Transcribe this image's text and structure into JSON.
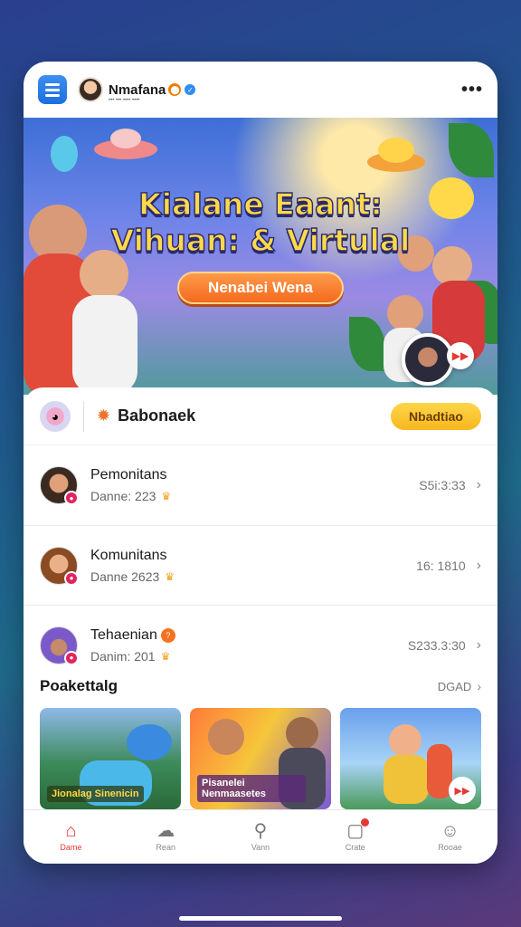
{
  "header": {
    "username": "Nmafana",
    "subtitle": "••• ••• •••• ••••",
    "more": "•••"
  },
  "banner": {
    "title_line1": "Kialane Eaant:",
    "title_line2": "Vihuan: & Virtulal",
    "cta_label": "Nenabei Wena"
  },
  "bonus": {
    "label": "Babonaek",
    "button_label": "Nbadtiao"
  },
  "list": [
    {
      "title": "Pemonitans",
      "sub": "Danne: 223",
      "value": "S5i:3:33",
      "badge": ""
    },
    {
      "title": "Komunitans",
      "sub": "Danne 2623",
      "value": "16: 1810",
      "badge": ""
    },
    {
      "title": "Tehaenian",
      "sub": "Danim: 201",
      "value": "S233.3:30",
      "badge": "?"
    }
  ],
  "section": {
    "title": "Poakettalg",
    "link": "DGAD"
  },
  "cards": [
    {
      "label": "Jionalag Sinenicin"
    },
    {
      "label": "Pisanelei Nenmaasetes"
    },
    {
      "label": ""
    }
  ],
  "bottom_nav": [
    {
      "label": "Dame",
      "icon": "home-icon"
    },
    {
      "label": "Rean",
      "icon": "discover-icon"
    },
    {
      "label": "Vann",
      "icon": "search-icon"
    },
    {
      "label": "Crate",
      "icon": "chat-icon"
    },
    {
      "label": "Rooae",
      "icon": "profile-icon"
    }
  ],
  "colors": {
    "accent": "#e53935",
    "cta_orange": "#f46a1e",
    "bonus_yellow": "#f6b81e",
    "menu_blue": "#1d6fe0"
  }
}
